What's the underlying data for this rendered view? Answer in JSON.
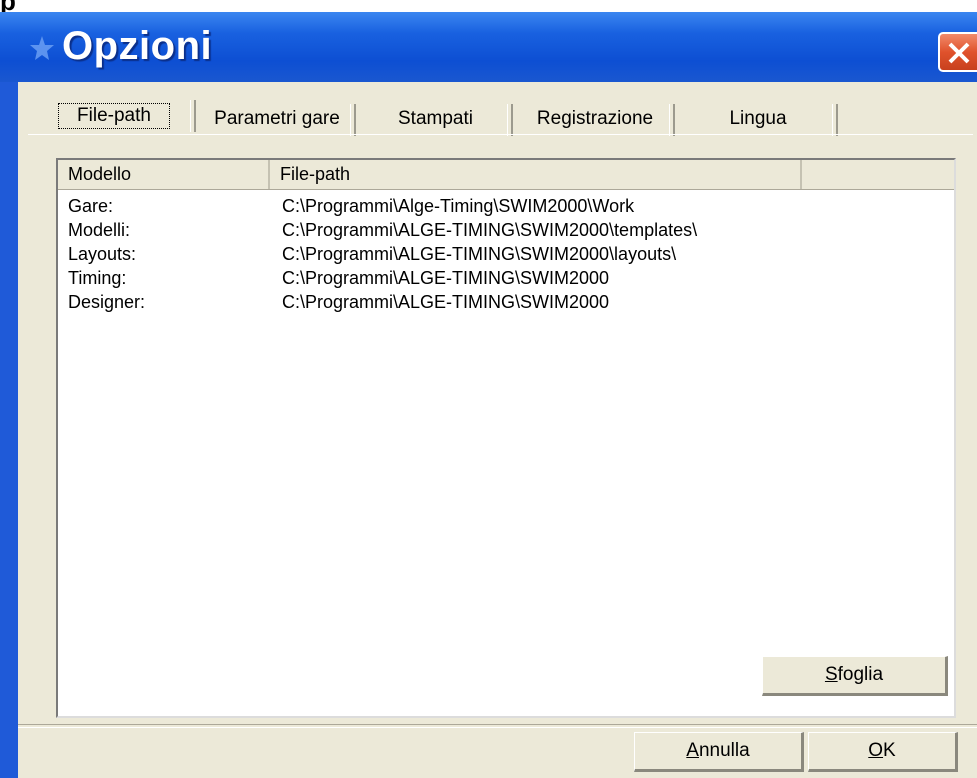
{
  "window": {
    "partial_title_glyph": "p",
    "title": "Opzioni"
  },
  "tabs": [
    {
      "label": "File-path",
      "active": true
    },
    {
      "label": "Parametri gare",
      "active": false
    },
    {
      "label": "Stampati",
      "active": false
    },
    {
      "label": "Registrazione",
      "active": false
    },
    {
      "label": "Lingua",
      "active": false
    }
  ],
  "list": {
    "columns": [
      "Modello",
      "File-path"
    ],
    "rows": [
      {
        "model": "Gare:",
        "path": "C:\\Programmi\\Alge-Timing\\SWIM2000\\Work"
      },
      {
        "model": "Modelli:",
        "path": "C:\\Programmi\\ALGE-TIMING\\SWIM2000\\templates\\"
      },
      {
        "model": "Layouts:",
        "path": "C:\\Programmi\\ALGE-TIMING\\SWIM2000\\layouts\\"
      },
      {
        "model": "Timing:",
        "path": "C:\\Programmi\\ALGE-TIMING\\SWIM2000"
      },
      {
        "model": "Designer:",
        "path": "C:\\Programmi\\ALGE-TIMING\\SWIM2000"
      }
    ]
  },
  "buttons": {
    "browse_pre": "",
    "browse_accel": "S",
    "browse_post": "foglia",
    "cancel_accel": "A",
    "cancel_post": "nnulla",
    "ok_accel": "O",
    "ok_post": "K"
  },
  "colors": {
    "titlebar": "#0d4fd3",
    "dialog": "#ece9d8",
    "close": "#e0522c"
  },
  "icons": {
    "title": "app-star-icon",
    "close": "close-icon"
  }
}
